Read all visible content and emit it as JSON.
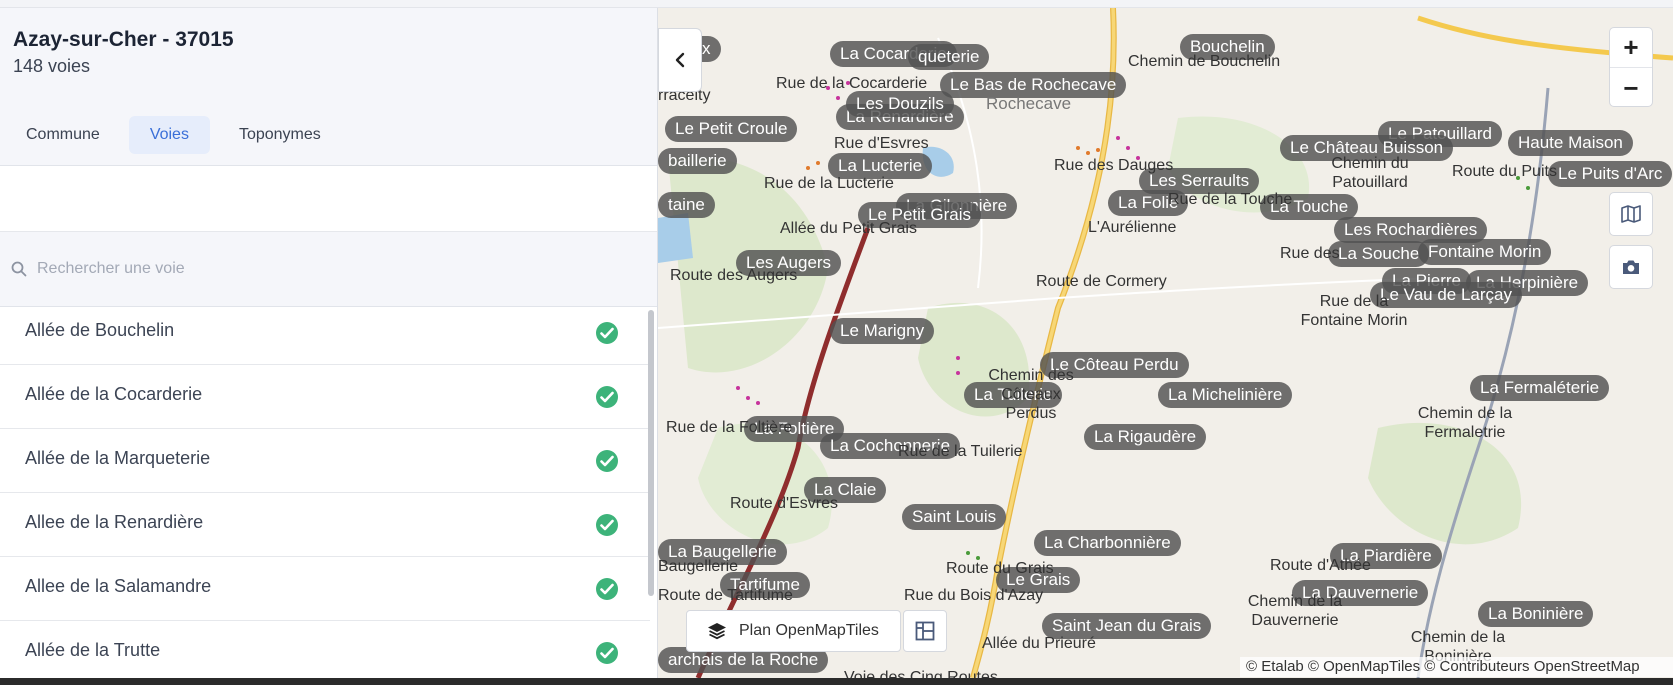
{
  "commune": {
    "title": "Azay-sur-Cher - 37015",
    "subtitle": "148 voies"
  },
  "tabs": [
    {
      "label": "Commune",
      "active": false
    },
    {
      "label": "Voies",
      "active": true
    },
    {
      "label": "Toponymes",
      "active": false
    }
  ],
  "search": {
    "placeholder": "Rechercher une voie",
    "value": ""
  },
  "voies": [
    {
      "label": "Allée de Bouchelin",
      "status": "certified"
    },
    {
      "label": "Allée de la Cocarderie",
      "status": "certified"
    },
    {
      "label": "Allée de la Marqueterie",
      "status": "certified"
    },
    {
      "label": "Allee de la Renardière",
      "status": "certified"
    },
    {
      "label": "Allee de la Salamandre",
      "status": "certified"
    },
    {
      "label": "Allée de la Trutte",
      "status": "certified"
    }
  ],
  "map": {
    "toponym_labels": [
      "reaux",
      "La Cocarderie",
      "queterie",
      "La Renardière",
      "Le Bas de Rochecave",
      "Les Douzils",
      "Bouchelin",
      "Le Petit Croule",
      "baillerie",
      "La Lucterie",
      "La Gilonnière",
      "Le Petit Grais",
      "taine",
      "Les Augers",
      "Les Serraults",
      "La Folie",
      "La Touche",
      "Le Patouillard",
      "Le Château Buisson",
      "Haute Maison",
      "Le Puits d'Arc",
      "Les Rochardières",
      "La Souche",
      "Fontaine Morin",
      "La Pierre",
      "La Herpinière",
      "Le Vau de Larçay",
      "Le Marigny",
      "Le Côteau Perdu",
      "La Tuilerie",
      "La Michelinière",
      "La Fermaléterie",
      "La Foltière",
      "La Cochonnerie",
      "La Rigaudère",
      "La Claie",
      "Saint Louis",
      "La Charbonnière",
      "La Baugellerie",
      "Tartifume",
      "Le Grais",
      "La Piardière",
      "La Dauvernerie",
      "Saint Jean du Grais",
      "La Boninière",
      "archais de la Roche"
    ],
    "road_labels": [
      "Chemin de Bouchelin",
      "Rue de la Cocarderie",
      "Rue d'Esvres",
      "Rue de la Lucterie",
      "Allée du Petit Grais",
      "Route des Augers",
      "Rue des Dauges",
      "Rue de la Touche",
      "L'Aurélienne",
      "Chemin du Patouillard",
      "Route du Puits",
      "Rue des",
      "Rue de la Fontaine Morin",
      "Route de Cormery",
      "Chemin des Côteaux Perdus",
      "Chemin de la Fermaletrie",
      "Rue de la Foltière",
      "Rue de la Tuilerie",
      "Route d'Esvres",
      "Route du Grais",
      "Rue du Bois d'Azay",
      "Route de Tartifume",
      "Route d'Athée",
      "Chemin de la Dauvernerie",
      "Allée du Prieuré",
      "Voie des Cinq Routes",
      "Chemin de la Boninière",
      "Rochecave",
      "Baugellerie",
      "rraceity"
    ],
    "layer_name": "Plan OpenMapTiles",
    "attribution": "© Etalab © OpenMapTiles © Contributeurs OpenStreetMap",
    "colors": {
      "road_main": "#8f2d2d",
      "road_yellow": "#f4c94e",
      "water": "#a8cde9",
      "vegetation": "#dde8cc",
      "label_bg": "#525252"
    }
  }
}
